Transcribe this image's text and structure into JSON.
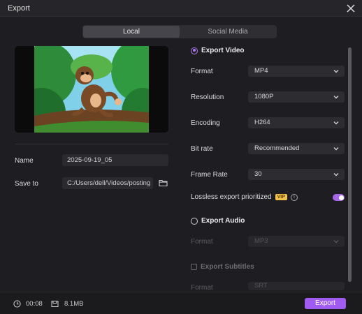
{
  "window": {
    "title": "Export"
  },
  "tabs": [
    {
      "label": "Local",
      "active": true
    },
    {
      "label": "Social Media",
      "active": false
    }
  ],
  "file": {
    "name_label": "Name",
    "name_value": "2025-09-19_05",
    "save_label": "Save to",
    "save_value": "C:/Users/dell/Videos/posting"
  },
  "video": {
    "heading": "Export Video",
    "format_label": "Format",
    "format_value": "MP4",
    "resolution_label": "Resolution",
    "resolution_value": "1080P",
    "encoding_label": "Encoding",
    "encoding_value": "H264",
    "bitrate_label": "Bit rate",
    "bitrate_value": "Recommended",
    "framerate_label": "Frame Rate",
    "framerate_value": "30",
    "lossless_label": "Lossless export prioritized",
    "vip_badge": "VIP",
    "lossless_enabled": true
  },
  "audio": {
    "heading": "Export Audio",
    "format_label": "Format",
    "format_value": "MP3"
  },
  "subtitles": {
    "heading": "Export Subtitles",
    "format_label": "Format",
    "format_value": "SRT"
  },
  "footer": {
    "duration": "00:08",
    "size": "8.1MB",
    "export_label": "Export"
  },
  "colors": {
    "accent": "#a05cf0",
    "vip": "#f3c24a",
    "background": "#1e1e22"
  }
}
